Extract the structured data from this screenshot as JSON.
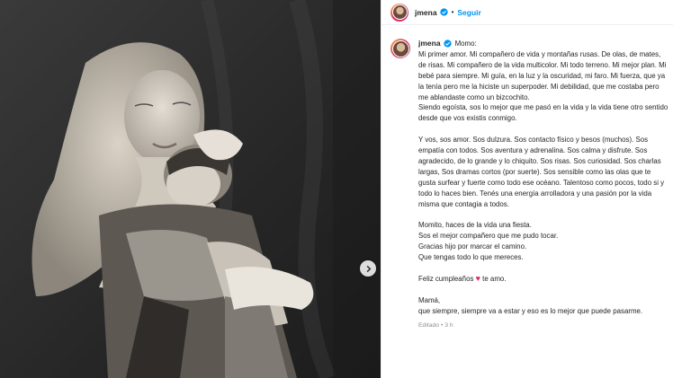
{
  "post": {
    "image_description": "",
    "header": {
      "username": "jmena",
      "separator": "•",
      "follow_label": "Seguir"
    },
    "caption": {
      "username": "jmena",
      "salutation": "Momo:",
      "paragraph_1": "Mi primer amor. Mi compañero de vida y montañas rusas. De olas, de mates, de risas. Mi compañero de la vida multicolor. Mi todo terreno. Mi mejor plan. Mi bebé para siempre. Mi guía, en la luz y la oscuridad, mi faro. Mi fuerza, que ya la tenía pero me la hiciste un superpoder. Mi debilidad, que me costaba pero me ablandaste como un bizcochito.",
      "paragraph_2": "Siendo egoísta, sos lo mejor que me pasó en la vida y la vida tiene otro sentido desde que vos existis conmigo.",
      "paragraph_3": "Y vos, sos amor. Sos dulzura. Sos contacto físico y besos (muchos). Sos empatía con todos. Sos aventura y adrenalina. Sos calma y disfrute. Sos agradecido, de lo grande y lo chiquito. Sos risas. Sos curiosidad. Sos charlas largas, Sos dramas cortos (por suerte). Sos sensible como las olas que te gusta surfear y fuerte como todo ese océano. Talentoso como pocos, todo si y todo lo haces bien. Tenés una energía arrolladora y una pasión por la vida misma que contagia a todos.",
      "line_4a": "Momito, haces de la vida una fiesta.",
      "line_4b": "Sos el mejor compañero que me pudo tocar.",
      "line_4c": "Gracias hijo por marcar el camino.",
      "line_4d": "Que tengas todo lo que mereces.",
      "birthday_before": "Feliz cumpleaños",
      "birthday_heart": "♥",
      "birthday_after": "te amo.",
      "closing_a": "Mamá,",
      "closing_b": "que siempre, siempre va a estar y eso es lo mejor que puede pasarme."
    },
    "meta": {
      "edited_label": "Editado",
      "separator": "•",
      "time_ago": "3 h"
    }
  },
  "icons": {
    "verified": "verified-badge-icon",
    "carousel_next": "chevron-right-icon",
    "heart": "red-heart-emoji"
  },
  "colors": {
    "accent": "#0095f6",
    "text": "#262626",
    "muted": "#8e8e8e",
    "heart": "#e0245e"
  }
}
